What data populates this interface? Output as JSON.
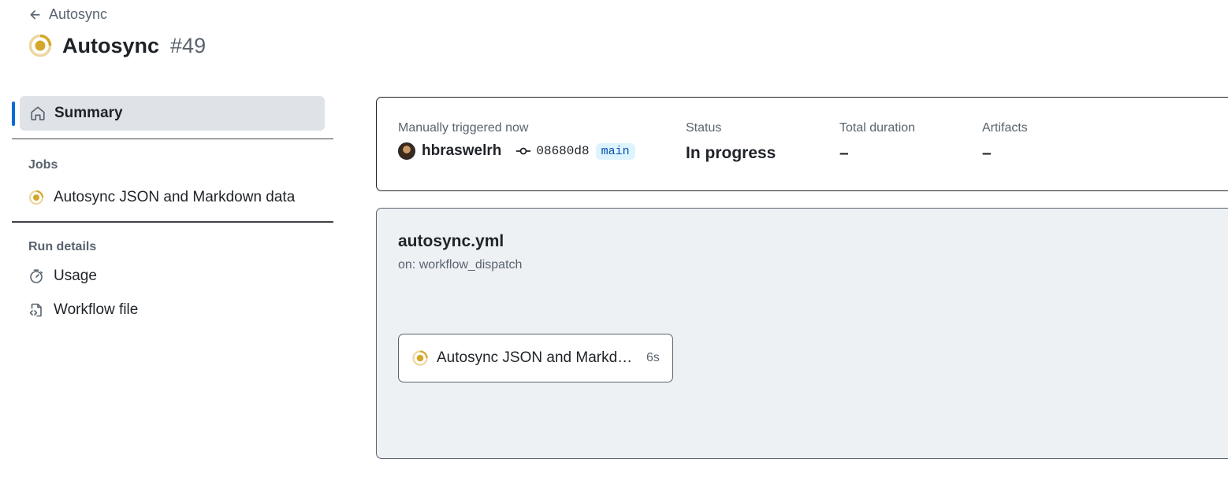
{
  "header": {
    "back_label": "Autosync",
    "title": "Autosync",
    "run_number": "#49",
    "status_color": "#d4a72c"
  },
  "sidebar": {
    "summary_label": "Summary",
    "jobs_heading": "Jobs",
    "jobs": [
      {
        "label": "Autosync JSON and Markdown data",
        "status": "in-progress-icon"
      }
    ],
    "run_details_heading": "Run details",
    "run_details": [
      {
        "label": "Usage",
        "icon": "stopwatch-icon"
      },
      {
        "label": "Workflow file",
        "icon": "file-code-icon"
      }
    ],
    "active_color": "#0969da"
  },
  "summary": {
    "trigger_label": "Manually triggered now",
    "actor": "hbraswelrh",
    "commit": "08680d8",
    "branch": "main",
    "status_label": "Status",
    "status_value": "In progress",
    "duration_label": "Total duration",
    "duration_value": "–",
    "artifacts_label": "Artifacts",
    "artifacts_value": "–"
  },
  "graph": {
    "workflow_file": "autosync.yml",
    "trigger": "on: workflow_dispatch",
    "job_name": "Autosync JSON and Markdown data",
    "job_duration": "6s"
  }
}
